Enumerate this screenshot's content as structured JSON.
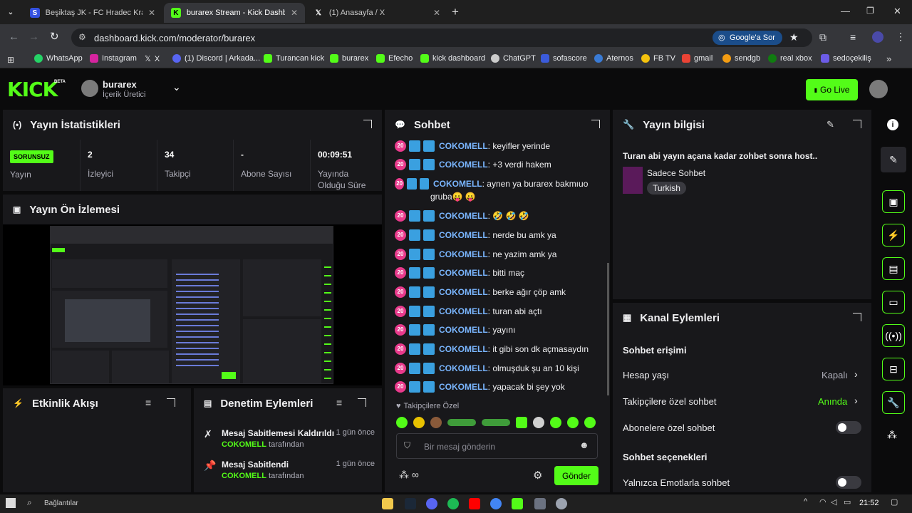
{
  "browser": {
    "tabs": [
      {
        "title": "Beşiktaş JK - FC Hradec Králové",
        "active": false
      },
      {
        "title": "burarex Stream - Kick Dashboar",
        "active": true
      },
      {
        "title": "(1) Anasayfa / X",
        "active": false
      }
    ],
    "url": "dashboard.kick.com/moderator/burarex",
    "google_sor": "Google'a Sor",
    "bookmarks": [
      "WhatsApp",
      "Instagram",
      "X",
      "(1) Discord | Arkada...",
      "Turancan kick",
      "burarex",
      "Efecho",
      "kick dashboard",
      "ChatGPT",
      "sofascore",
      "Aternos",
      "FB TV",
      "gmail",
      "sendgb",
      "real xbox",
      "sedoçekiliş"
    ]
  },
  "header": {
    "logo": "KICK",
    "beta": "BETA",
    "channel_name": "burarex",
    "channel_role": "İçerik Üretici",
    "go_live": "Go Live"
  },
  "stats": {
    "title": "Yayın İstatistikleri",
    "status_badge": "SORUNSUZ",
    "status_label": "Yayın",
    "viewers": {
      "value": "2",
      "label": "İzleyici"
    },
    "followers": {
      "value": "34",
      "label": "Takipçi"
    },
    "subs": {
      "value": "-",
      "label": "Abone Sayısı"
    },
    "uptime": {
      "value": "00:09:51",
      "label": "Yayında Olduğu Süre"
    }
  },
  "preview": {
    "title": "Yayın Ön İzlemesi"
  },
  "activity": {
    "title": "Etkinlik Akışı"
  },
  "modactions": {
    "title": "Denetim Eylemleri",
    "items": [
      {
        "action": "Mesaj Sabitlemesi Kaldırıldı",
        "time": "1 gün önce",
        "user": "COKOMELL",
        "suffix": "tarafından"
      },
      {
        "action": "Mesaj Sabitlendi",
        "time": "1 gün önce",
        "user": "COKOMELL",
        "suffix": "tarafından"
      }
    ]
  },
  "chat": {
    "title": "Sohbet",
    "badge": "20",
    "messages": [
      {
        "user": "COKOMELL",
        "text": "keyifler yerinde"
      },
      {
        "user": "COKOMELL",
        "text": "+3 verdi hakem"
      },
      {
        "user": "COKOMELL",
        "text": "aynen ya burarex bakmıuo gruba😛 😛"
      },
      {
        "user": "COKOMELL",
        "text": "🤣 🤣 🤣"
      },
      {
        "user": "COKOMELL",
        "text": "nerde bu amk ya"
      },
      {
        "user": "COKOMELL",
        "text": "ne yazim amk ya"
      },
      {
        "user": "COKOMELL",
        "text": "bitti maç"
      },
      {
        "user": "COKOMELL",
        "text": "berke ağır çöp amk"
      },
      {
        "user": "COKOMELL",
        "text": "turan abi açtı"
      },
      {
        "user": "COKOMELL",
        "text": "yayını"
      },
      {
        "user": "COKOMELL",
        "text": "it gibi son dk açmasaydın"
      },
      {
        "user": "COKOMELL",
        "text": "olmuşduk şu an 10 kişi"
      },
      {
        "user": "COKOMELL",
        "text": "yapacak bi şey yok"
      }
    ],
    "followers_only": "Takipçilere Özel",
    "input_placeholder": "Bir mesaj gönderin",
    "send": "Gönder"
  },
  "streaminfo": {
    "title": "Yayın bilgisi",
    "stream_title": "Turan abi yayın açana kadar zohbet sonra host..",
    "category": "Sadece Sohbet",
    "language": "Turkish"
  },
  "channel_actions": {
    "title": "Kanal Eylemleri",
    "chat_access": "Sohbet erişimi",
    "account_age": {
      "label": "Hesap yaşı",
      "value": "Kapalı"
    },
    "followers_chat": {
      "label": "Takipçilere özel sohbet",
      "value": "Anında"
    },
    "subs_chat": {
      "label": "Abonelere özel sohbet"
    },
    "chat_options": "Sohbet seçenekleri",
    "emote_only": {
      "label": "Yalnızca Emotlarla sohbet"
    }
  },
  "taskbar": {
    "search": "Bağlantılar",
    "time": "21:52"
  },
  "colors": {
    "accent": "#53fc18",
    "panel": "#18181b",
    "user": "#7ab6ff"
  }
}
